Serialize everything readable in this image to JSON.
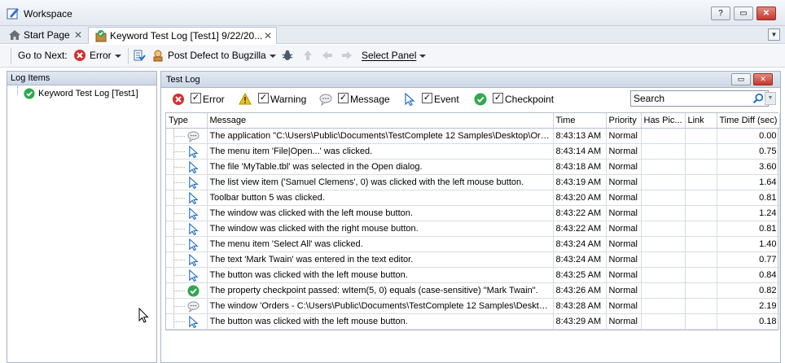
{
  "window": {
    "title": "Workspace",
    "help_btn": "?",
    "restore_btn": "▭",
    "close_btn": "✕"
  },
  "tabs": [
    {
      "label": "Start Page",
      "close": "✕"
    },
    {
      "label": "Keyword Test Log [Test1] 9/22/20...",
      "close": "✕"
    }
  ],
  "tab_dropdown": "▼",
  "toolbar": {
    "go_to_next": "Go to Next:",
    "error": "Error",
    "post_defect": "Post Defect to Bugzilla",
    "select_panel": "Select Panel"
  },
  "log_items": {
    "header": "Log Items",
    "tree": [
      "Keyword Test Log [Test1]"
    ]
  },
  "test_log": {
    "header": "Test Log",
    "filters": [
      "Error",
      "Warning",
      "Message",
      "Event",
      "Checkpoint"
    ],
    "search_placeholder": "Search",
    "columns": [
      "Type",
      "Message",
      "Time",
      "Priority",
      "Has Pic...",
      "Link",
      "Time Diff (sec)"
    ],
    "rows": [
      {
        "type": "message",
        "message": "The application \"C:\\Users\\Public\\Documents\\TestComplete 12 Samples\\Desktop\\Orde...",
        "time": "8:43:13 AM",
        "priority": "Normal",
        "diff": "0.00"
      },
      {
        "type": "event",
        "message": "The menu item 'File|Open...' was clicked.",
        "time": "8:43:14 AM",
        "priority": "Normal",
        "diff": "0.75"
      },
      {
        "type": "event",
        "message": "The file 'MyTable.tbl' was selected in the Open dialog.",
        "time": "8:43:18 AM",
        "priority": "Normal",
        "diff": "3.60"
      },
      {
        "type": "event",
        "message": "The list view item ('Samuel Clemens', 0) was clicked with the left mouse button.",
        "time": "8:43:19 AM",
        "priority": "Normal",
        "diff": "1.64"
      },
      {
        "type": "event",
        "message": "Toolbar button 5 was clicked.",
        "time": "8:43:20 AM",
        "priority": "Normal",
        "diff": "0.81"
      },
      {
        "type": "event",
        "message": "The window was clicked with the left mouse button.",
        "time": "8:43:22 AM",
        "priority": "Normal",
        "diff": "1.24"
      },
      {
        "type": "event",
        "message": "The window was clicked with the right mouse button.",
        "time": "8:43:22 AM",
        "priority": "Normal",
        "diff": "0.81"
      },
      {
        "type": "event",
        "message": "The menu item 'Select All' was clicked.",
        "time": "8:43:24 AM",
        "priority": "Normal",
        "diff": "1.40"
      },
      {
        "type": "event",
        "message": "The text 'Mark Twain' was entered in the text editor.",
        "time": "8:43:24 AM",
        "priority": "Normal",
        "diff": "0.77"
      },
      {
        "type": "event",
        "message": "The button was clicked with the left mouse button.",
        "time": "8:43:25 AM",
        "priority": "Normal",
        "diff": "0.84"
      },
      {
        "type": "checkpoint",
        "message": "The property checkpoint passed: wItem(5, 0) equals (case-sensitive) \"Mark Twain\".",
        "time": "8:43:26 AM",
        "priority": "Normal",
        "diff": "0.82"
      },
      {
        "type": "message",
        "message": "The window 'Orders - C:\\Users\\Public\\Documents\\TestComplete 12 Samples\\Desktop...",
        "time": "8:43:28 AM",
        "priority": "Normal",
        "diff": "2.19"
      },
      {
        "type": "event",
        "message": "The button was clicked with the left mouse button.",
        "time": "8:43:29 AM",
        "priority": "Normal",
        "diff": "0.18"
      }
    ]
  },
  "colors": {
    "accent": "#1f6fc5",
    "error": "#d32f2f",
    "ok": "#2fa84f",
    "warning": "#f0c419"
  }
}
